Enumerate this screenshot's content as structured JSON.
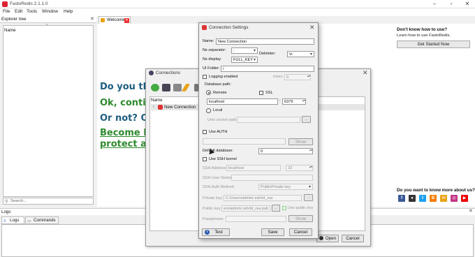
{
  "window": {
    "title": "FastoRedis 2.1.1.0"
  },
  "menu": [
    "File",
    "Edit",
    "Tools",
    "Window",
    "Help"
  ],
  "explorer": {
    "title": "Explorer tree",
    "column": "Name",
    "search_placeholder": "Search..."
  },
  "tabs": {
    "welcome": "Welcome"
  },
  "welcome": {
    "line1": "Do you thi",
    "line2": "Ok, contin",
    "line3": "Or not? Ol",
    "line4": "Become P",
    "line5": "protect an",
    "dont_know": "Don't know how to use?",
    "learn": "Learn how to use FastoRedis.",
    "get_started": "Get Started Now",
    "know_more": "Do you want to know more about us?",
    "social_icons": [
      "facebook-icon",
      "github-icon",
      "twitter-icon",
      "blogger-icon",
      "email-icon",
      "instagram-icon",
      "youtube-icon"
    ],
    "colors": {
      "blue_text": "#1e5e80",
      "green_text": "#2e8a2e"
    }
  },
  "logs": {
    "title": "Logs",
    "tab_logs": "Logs",
    "tab_commands": "Commands"
  },
  "connections": {
    "title": "Connections",
    "column": "Name",
    "rows": [
      "New Connection"
    ],
    "open": "Open",
    "cancel": "Cancel"
  },
  "settings": {
    "title": "Connection Settings",
    "name_label": "Name:",
    "name_value": "New Connection",
    "ns_sep_label": "Ns separator:",
    "ns_sep_value": ":",
    "delimiter_label": "Delimiter:",
    "delimiter_value": "\\n",
    "ns_display_label": "Ns display:",
    "ns_display_value": "FULL_KEY",
    "ui_folder_label": "UI Folder:",
    "ui_folder_value": "/",
    "logging_label": "Logging enabled",
    "msec_label": "msec:",
    "msec_value": "0",
    "db_path_label": "Database path:",
    "remote_label": "Remote",
    "ssl_label": "SSL",
    "host_value": "localhost",
    "port_value": "6379",
    "local_label": "Local",
    "unix_label": "Unix socket path:",
    "unix_btn": "...",
    "auth_label": "Use AUTH",
    "show_label": "Show",
    "default_db_label": "Default database:",
    "default_db_value": "0",
    "ssh_label": "Use SSH tunnel",
    "ssh_address_label": "SSH Address:",
    "ssh_address_value": "localhost",
    "ssh_port_value": "22",
    "ssh_user_label": "SSH User Name:",
    "ssh_auth_label": "SSH Auth Method:",
    "ssh_auth_value": "PublicPrivate key",
    "private_key_label": "Private key:",
    "private_key_value": "C:/Users/admin/.ssh/id_rsa",
    "public_key_label": "Public key:",
    "public_key_value": "ers/admin/.ssh/id_rsa.pub",
    "use_public_key_label": "Use public key",
    "passphrase_label": "Passphrase:",
    "test": "Test",
    "save": "Save",
    "cancel": "Cancel"
  }
}
